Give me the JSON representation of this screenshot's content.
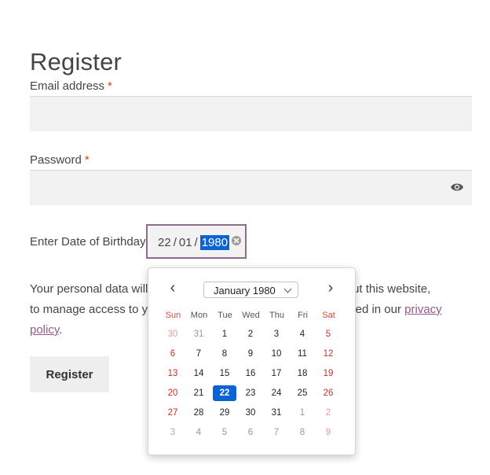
{
  "title": "Register",
  "email": {
    "label": "Email address",
    "required": "*"
  },
  "password": {
    "label": "Password",
    "required": "*"
  },
  "dob": {
    "label": "Enter Date of Birthday",
    "day": "22",
    "month": "01",
    "year": "1980",
    "sep": "/"
  },
  "privacy": {
    "line1": "Your personal data will",
    "line1_tail": "oughout this website,",
    "line2": "to manage access to yo",
    "line2_tail": "cribed in our",
    "link_a": "privacy",
    "link_b": "policy",
    "period": "."
  },
  "register_button": "Register",
  "calendar": {
    "month_label": "January 1980",
    "weekdays": [
      "Sun",
      "Mon",
      "Tue",
      "Wed",
      "Thu",
      "Fri",
      "Sat"
    ],
    "weeks": [
      [
        {
          "d": "30",
          "out": true
        },
        {
          "d": "31",
          "out": true
        },
        {
          "d": "1"
        },
        {
          "d": "2"
        },
        {
          "d": "3"
        },
        {
          "d": "4"
        },
        {
          "d": "5"
        }
      ],
      [
        {
          "d": "6"
        },
        {
          "d": "7"
        },
        {
          "d": "8"
        },
        {
          "d": "9"
        },
        {
          "d": "10"
        },
        {
          "d": "11"
        },
        {
          "d": "12"
        }
      ],
      [
        {
          "d": "13"
        },
        {
          "d": "14"
        },
        {
          "d": "15"
        },
        {
          "d": "16"
        },
        {
          "d": "17"
        },
        {
          "d": "18"
        },
        {
          "d": "19"
        }
      ],
      [
        {
          "d": "20"
        },
        {
          "d": "21"
        },
        {
          "d": "22",
          "selected": true
        },
        {
          "d": "23"
        },
        {
          "d": "24"
        },
        {
          "d": "25"
        },
        {
          "d": "26"
        }
      ],
      [
        {
          "d": "27"
        },
        {
          "d": "28"
        },
        {
          "d": "29"
        },
        {
          "d": "30"
        },
        {
          "d": "31"
        },
        {
          "d": "1",
          "out": true
        },
        {
          "d": "2",
          "out": true
        }
      ],
      [
        {
          "d": "3",
          "out": true
        },
        {
          "d": "4",
          "out": true
        },
        {
          "d": "5",
          "out": true
        },
        {
          "d": "6",
          "out": true
        },
        {
          "d": "7",
          "out": true
        },
        {
          "d": "8",
          "out": true
        },
        {
          "d": "9",
          "out": true
        }
      ]
    ]
  },
  "colors": {
    "accent": "#96588a",
    "selected": "#0a64d4",
    "required": "#e2401c",
    "weekend": "#c8302a"
  }
}
